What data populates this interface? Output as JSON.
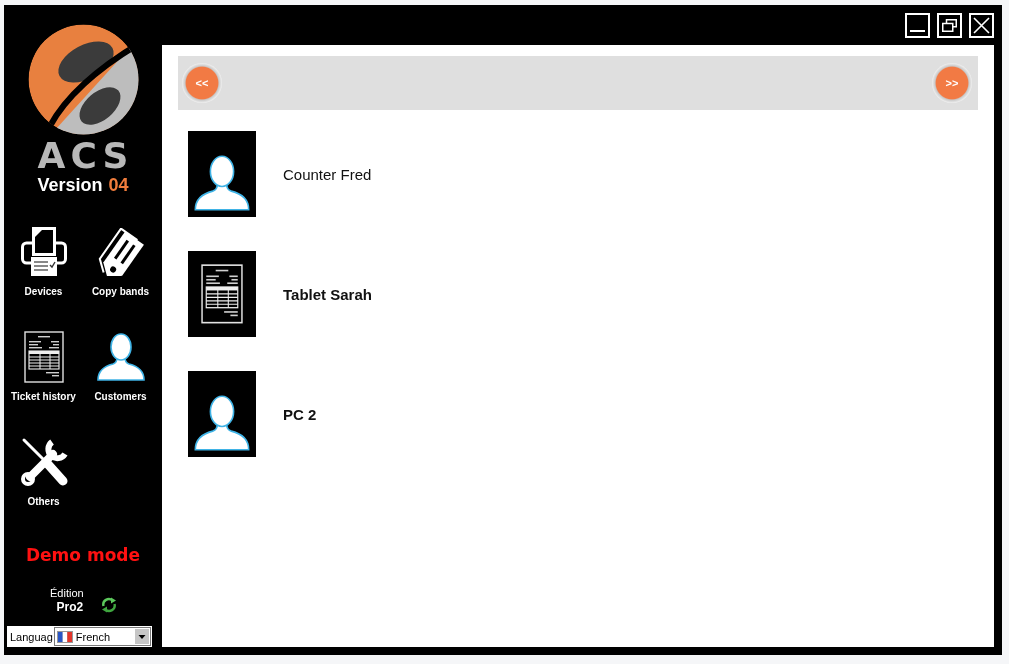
{
  "sidebar": {
    "logo_text": "ACS",
    "version_label": "Version",
    "version_number": "04",
    "items": [
      {
        "label": "Devices",
        "kind": "printer"
      },
      {
        "label": "Copy bands",
        "kind": "tag"
      },
      {
        "label": "Ticket history",
        "kind": "document"
      },
      {
        "label": "Customers",
        "kind": "person"
      },
      {
        "label": "Others",
        "kind": "tools"
      }
    ],
    "mode_notice": "Demo mode",
    "edition": {
      "label": "Édition",
      "value": "Pro2"
    },
    "language": {
      "label": "Languag",
      "value": "French"
    }
  },
  "pager": {
    "previous_label": "<<",
    "next_label": ">>"
  },
  "entries": [
    {
      "name": "Counter Fred",
      "kind": "person",
      "bold": false
    },
    {
      "name": "Tablet Sarah",
      "kind": "document",
      "bold": true
    },
    {
      "name": "PC 2",
      "kind": "person",
      "bold": true
    }
  ]
}
